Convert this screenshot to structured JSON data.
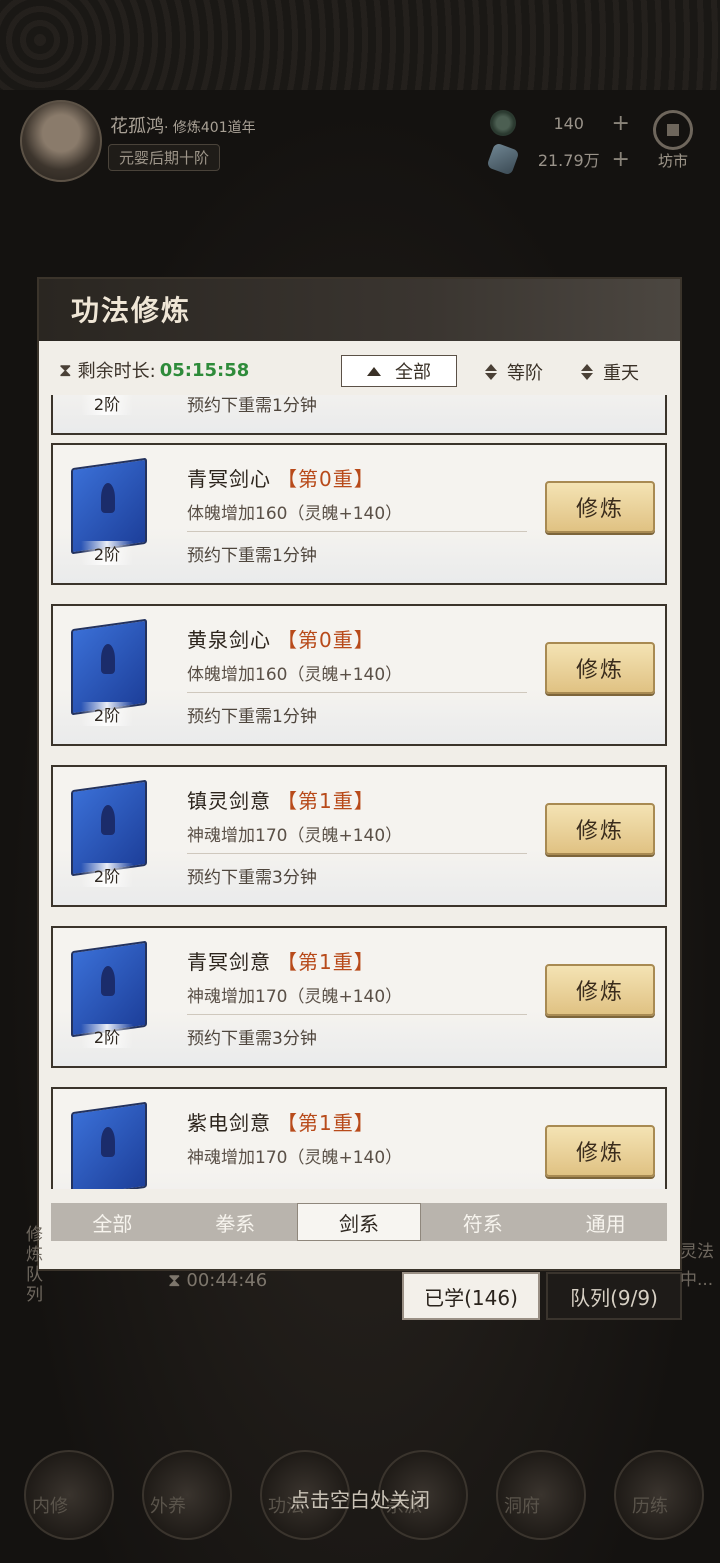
{
  "player": {
    "name": "花孤鸿",
    "cultivation": "· 修炼401道年",
    "realm": "元婴后期十阶"
  },
  "resources": [
    {
      "icon": "jade-icon",
      "value": "140",
      "plus": "+"
    },
    {
      "icon": "spirit-stone-icon",
      "value": "21.79万",
      "plus": "+"
    }
  ],
  "market_label": "坊市",
  "panel": {
    "title": "功法修炼",
    "remaining_label": "剩余时长:",
    "remaining_time": "05:15:58",
    "filter_label": "全部",
    "sort_tier": "等阶",
    "sort_layer": "重天"
  },
  "partial_top": {
    "tier": "2阶",
    "note": "预约下重需1分钟"
  },
  "skills": [
    {
      "name": "青冥剑心",
      "level": "【第0重】",
      "effect": "体魄增加160（灵魄+140）",
      "note": "预约下重需1分钟",
      "tier": "2阶",
      "button": "修炼"
    },
    {
      "name": "黄泉剑心",
      "level": "【第0重】",
      "effect": "体魄增加160（灵魄+140）",
      "note": "预约下重需1分钟",
      "tier": "2阶",
      "button": "修炼"
    },
    {
      "name": "镇灵剑意",
      "level": "【第1重】",
      "effect": "神魂增加170（灵魄+140）",
      "note": "预约下重需3分钟",
      "tier": "2阶",
      "button": "修炼"
    },
    {
      "name": "青冥剑意",
      "level": "【第1重】",
      "effect": "神魂增加170（灵魄+140）",
      "note": "预约下重需3分钟",
      "tier": "2阶",
      "button": "修炼"
    },
    {
      "name": "紫电剑意",
      "level": "【第1重】",
      "effect": "神魂增加170（灵魄+140）",
      "note": "",
      "tier": "",
      "button": "修炼"
    }
  ],
  "tabs": [
    "全部",
    "拳系",
    "剑系",
    "符系",
    "通用"
  ],
  "active_tab": "剑系",
  "below": {
    "timer": "00:44:46",
    "learned": "已学(146)",
    "queue": "队列(9/9)",
    "side_left": "修炼队列",
    "side_right_1": "灵法",
    "side_right_2": "中..."
  },
  "close_hint": "点击空白处关闭",
  "nav": [
    {
      "label": "内修"
    },
    {
      "label": "外养"
    },
    {
      "label": "功法"
    },
    {
      "label": "宗派"
    },
    {
      "label": "洞府"
    },
    {
      "label": "历练"
    }
  ]
}
